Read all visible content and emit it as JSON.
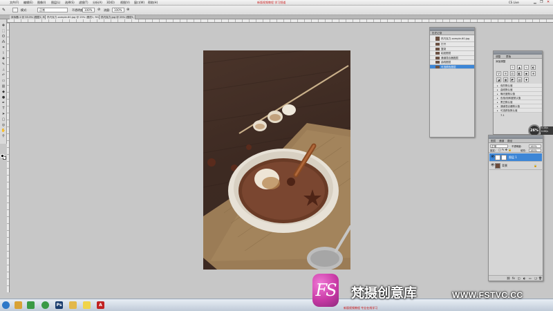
{
  "menubar": {
    "items": [
      "文件(F)",
      "编辑(E)",
      "图像(I)",
      "图层(L)",
      "选择(S)",
      "滤镜(T)",
      "分析(A)",
      "3D(D)",
      "视图(V)",
      "窗口(W)",
      "帮助(H)"
    ],
    "center_title": "新版视频教程  学习频道",
    "workspace": "CS Live"
  },
  "options": {
    "mode_label": "模式:",
    "mode_value": "正常",
    "opacity_label": "不透明度:",
    "opacity_value": "100%",
    "flow_label": "流量:",
    "flow_value": "100%"
  },
  "tabs": [
    {
      "label": "未标题-1 @ 33.3% (图层1, RGB/8)"
    },
    {
      "label": "热巧克力-sample-60.jpg @ 25% (图层1, RGB/8)"
    },
    {
      "label": "热巧克力.jpg @ 25% (图层1, RGB/8)"
    }
  ],
  "history_panel": {
    "title": "历史记录",
    "items": [
      {
        "label": "热巧克力-sample-60.jpg"
      },
      {
        "label": "打开"
      },
      {
        "label": "复制"
      },
      {
        "label": "粘贴图层"
      },
      {
        "label": "通道混合器图层"
      },
      {
        "label": "曲线图层"
      },
      {
        "label": "可选颜色图层"
      }
    ],
    "selected_index": 6
  },
  "adjust_panel": {
    "tabs": [
      "调整",
      "蒙版"
    ],
    "header": "添加调整",
    "presets": [
      "色阶默认值",
      "曲线默认值",
      "曝光度默认值",
      "色相/饱和度默认值",
      "黑白默认值",
      "通道混合器默认值",
      "可选颜色默认值"
    ],
    "footer": "7.1"
  },
  "layers_panel": {
    "tabs": [
      "图层",
      "通道",
      "路径"
    ],
    "blend_mode": "正常",
    "opacity_label": "不透明度:",
    "opacity": "100%",
    "lock_label": "锁定:",
    "fill_label": "填充:",
    "fill": "100%",
    "layers": [
      {
        "label": "图层 1",
        "selected": true
      },
      {
        "label": "背景",
        "selected": false
      }
    ]
  },
  "speed_widget": {
    "percent": "26%",
    "up": "0.1K/s",
    "down": "0.0K/s"
  },
  "taskbar": {
    "start_label": "开始",
    "apps": [
      {
        "name": "start-orb",
        "glyph": "",
        "color": "#2e78c8"
      },
      {
        "name": "explorer",
        "glyph": "",
        "color": "#d8a235"
      },
      {
        "name": "chrome",
        "glyph": "",
        "color": "#3a9a45"
      },
      {
        "name": "photoshop",
        "glyph": "Ps",
        "color": "#1a3d6e"
      },
      {
        "name": "folder",
        "glyph": "",
        "color": "#e3b84a"
      },
      {
        "name": "notes",
        "glyph": "",
        "color": "#f0d44a"
      },
      {
        "name": "acrobat",
        "glyph": "A",
        "color": "#c12222"
      }
    ],
    "notice": "新版视频教程 专业在线学习"
  },
  "watermark": {
    "logo_text": "FS",
    "brand_cn": "梵摄创意库",
    "url": "WWW.FSTVC.CC"
  }
}
